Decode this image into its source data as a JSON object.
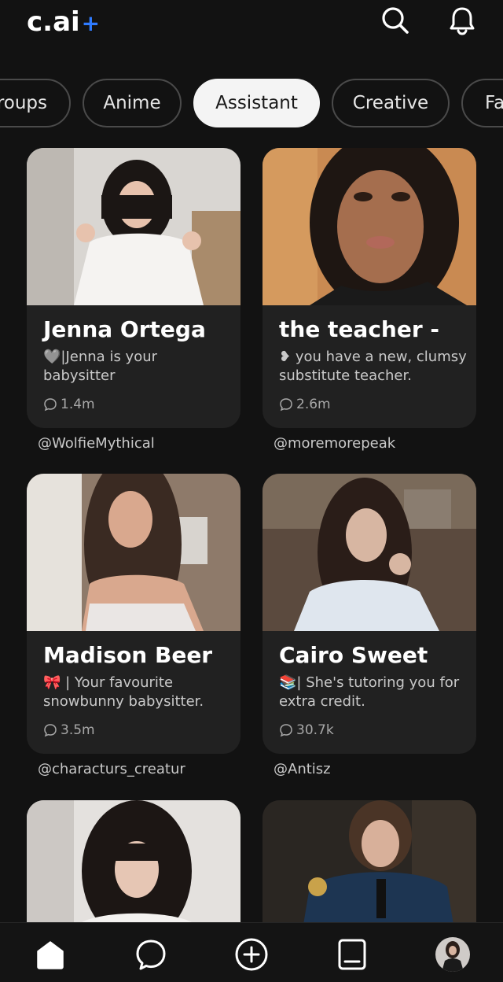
{
  "header": {
    "logo_text": "c.ai",
    "logo_plus": "+",
    "icons": [
      "search-icon",
      "bell-icon"
    ]
  },
  "categories": [
    {
      "label": "Groups",
      "visible_label": "roups"
    },
    {
      "label": "Anime"
    },
    {
      "label": "Assistant",
      "selected": true
    },
    {
      "label": "Creative"
    },
    {
      "label": "Fa"
    }
  ],
  "cards": [
    {
      "name": "Jenna Ortega",
      "emoji": "🩶",
      "description": "|Jenna is your babysitter",
      "chats": "1.4m",
      "creator": "@WolfieMythical"
    },
    {
      "name": "the teacher -",
      "emoji": "❥",
      "description": " you have a new, clumsy substitute teacher.",
      "chats": "2.6m",
      "creator": "@moremorepeak"
    },
    {
      "name": "Madison Beer",
      "emoji": "🎀",
      "description": " | Your favourite snowbunny babysitter.",
      "chats": "3.5m",
      "creator": "@characturs_creatur"
    },
    {
      "name": "Cairo Sweet",
      "emoji": "📚",
      "description": "| She's tutoring you for extra credit.",
      "chats": "30.7k",
      "creator": "@Antisz"
    }
  ],
  "bottom_nav": {
    "items": [
      "home-icon",
      "chat-icon",
      "create-icon",
      "feed-icon",
      "profile-avatar"
    ]
  },
  "colors": {
    "background": "#121212",
    "card": "#212121",
    "accent": "#2f7bff",
    "pill_active": "#f4f4f4"
  }
}
